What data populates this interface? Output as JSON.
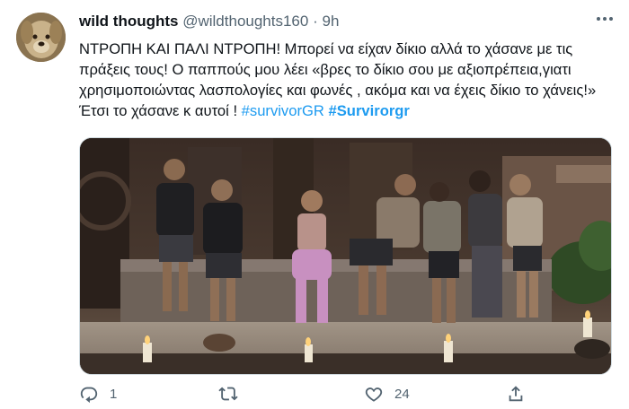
{
  "author": {
    "display_name": "wild thoughts",
    "handle": "@wildthoughts160",
    "separator": "·",
    "time": "9h",
    "avatar_icon": "dog-avatar"
  },
  "more_icon": "more-icon",
  "tweet": {
    "text_main": "ΝΤΡΟΠΗ ΚΑΙ ΠΑΛΙ ΝΤΡΟΠΗ! Μπορεί να είχαν δίκιο αλλά το χάσανε με τις πράξεις τους! Ο παππούς μου λέει «βρες το δίκιο σου με αξιοπρέπεια,γιατι χρησιμοποιώντας λασπολογίες και φωνές , ακόμα και να έχεις δίκιο το χάνεις!» Έτσι το χάσανε κ αυτοί ! ",
    "hashtag_1": "#survivorGR",
    "hashtag_2": "#Survirorgr"
  },
  "actions": {
    "reply_count": "1",
    "retweet_count": "",
    "like_count": "24",
    "reply_icon": "reply-icon",
    "retweet_icon": "retweet-icon",
    "like_icon": "like-icon",
    "share_icon": "share-icon"
  },
  "colors": {
    "link": "#1d9bf0",
    "secondary_text": "#536471",
    "primary_text": "#0f1419"
  }
}
